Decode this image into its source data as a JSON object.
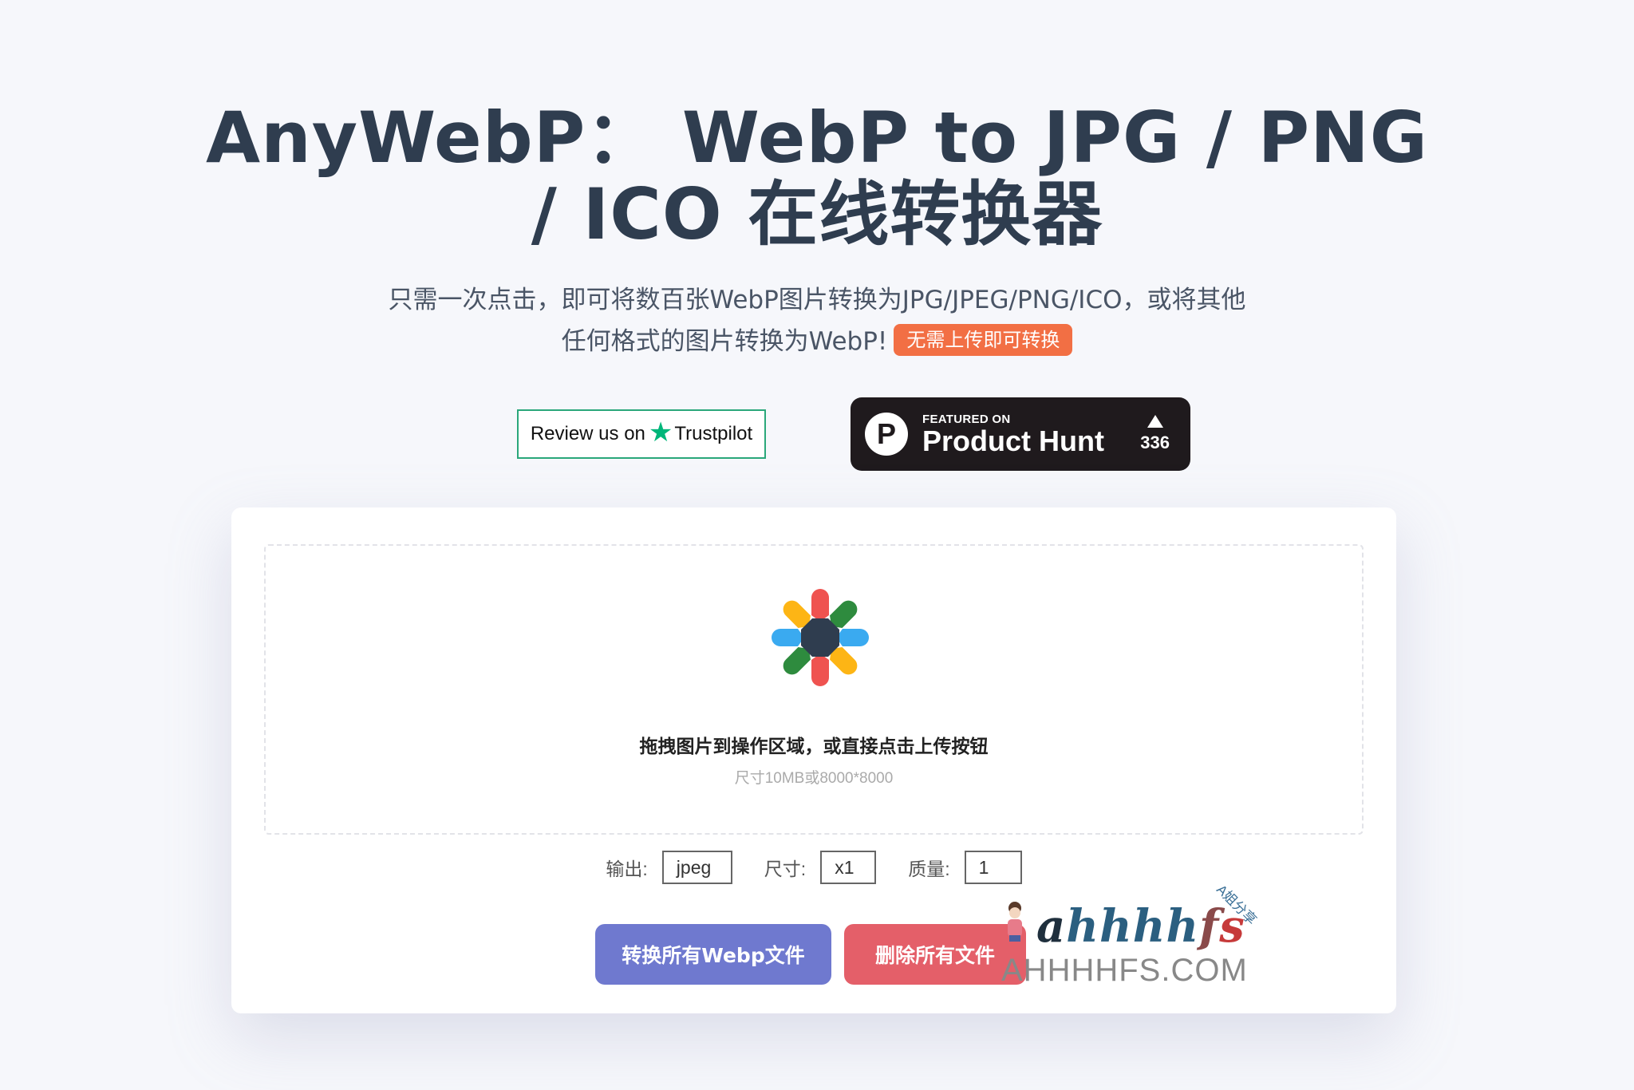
{
  "header": {
    "title_line1": "AnyWebP： WebP to JPG / PNG",
    "title_line2": "/ ICO 在线转换器",
    "subtitle_line1": "只需一次点击，即可将数百张WebP图片转换为JPG/JPEG/PNG/ICO，或将其他",
    "subtitle_line2": "任何格式的图片转换为WebP!",
    "badge": "无需上传即可转换"
  },
  "trustpilot": {
    "prefix": "Review us on",
    "icon": "star-icon",
    "brand": "Trustpilot"
  },
  "producthunt": {
    "logo_letter": "P",
    "small": "FEATURED ON",
    "big": "Product Hunt",
    "vote_icon": "upvote-triangle-icon",
    "votes": "336"
  },
  "dropzone": {
    "icon": "anywebp-flower-logo",
    "main_text": "拖拽图片到操作区域，或直接点击上传按钮",
    "limit_text": "尺寸10MB或8000*8000",
    "colors": {
      "red": "#ef5350",
      "yellow": "#fdb515",
      "green": "#2e8b3e",
      "blue": "#3aaaf0",
      "center": "#2f3d4f"
    }
  },
  "options": {
    "output_label": "输出:",
    "output_value": "jpeg",
    "size_label": "尺寸:",
    "size_value": "x1",
    "quality_label": "质量:",
    "quality_value": "1"
  },
  "actions": {
    "convert_all": "转换所有Webp文件",
    "delete_all": "删除所有文件"
  },
  "watermark": {
    "script": "ahhhhfs",
    "tag": "A姐分享",
    "domain": "AHHHHFS.COM"
  }
}
